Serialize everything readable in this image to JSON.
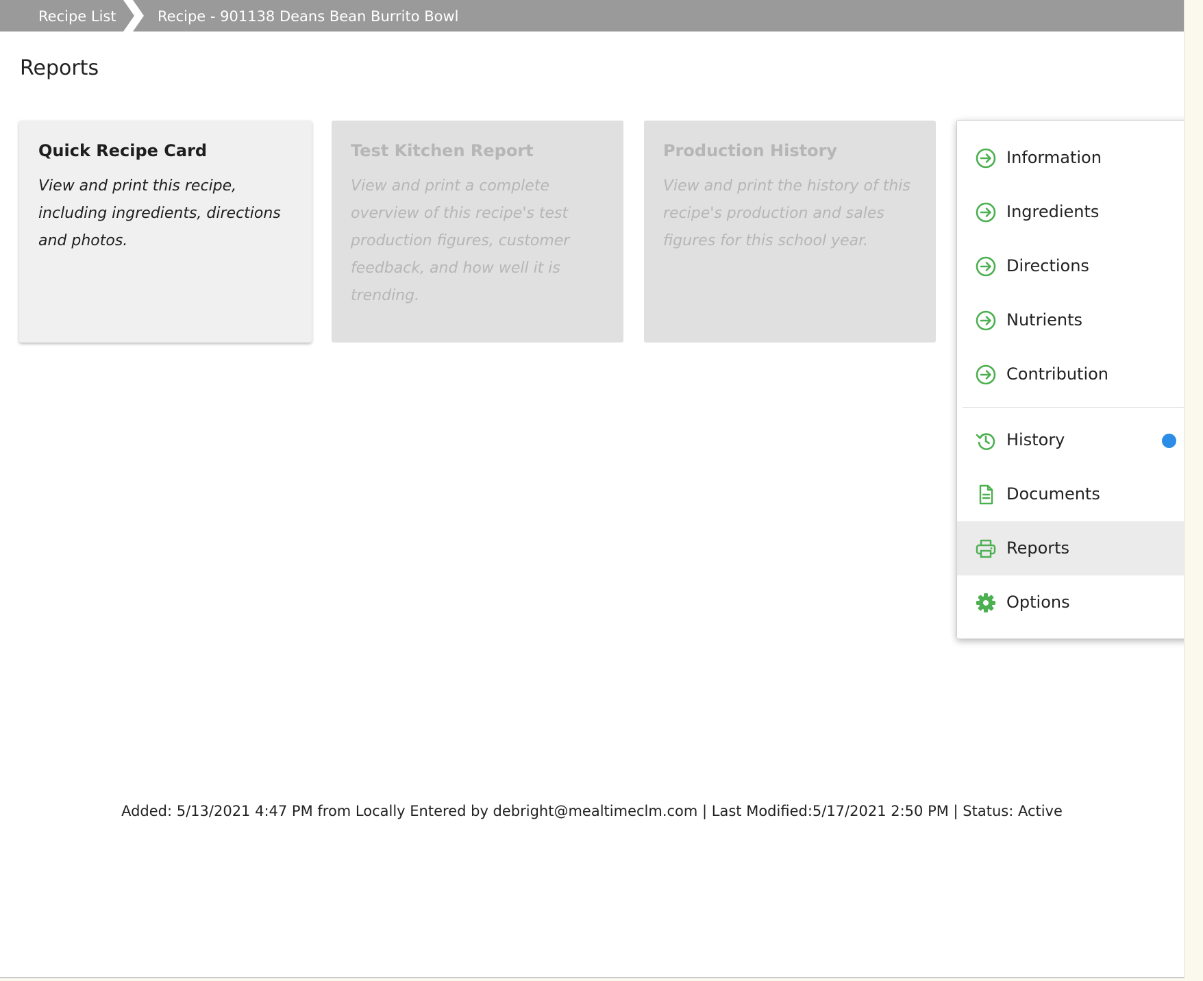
{
  "breadcrumb": {
    "items": [
      "Recipe List",
      "Recipe - 901138 Deans Bean Burrito Bowl"
    ]
  },
  "page": {
    "title": "Reports"
  },
  "cards": [
    {
      "title": "Quick Recipe Card",
      "description": "View and print this recipe, including ingredients, directions and photos.",
      "enabled": true
    },
    {
      "title": "Test Kitchen Report",
      "description": "View and print a complete overview of this recipe's test production figures, customer feedback, and how well it is trending.",
      "enabled": false
    },
    {
      "title": "Production History",
      "description": "View and print the history of this recipe's production and sales figures for this school year.",
      "enabled": false
    }
  ],
  "menu": {
    "items": [
      {
        "label": "Information",
        "icon": "arrow-circle-right-icon"
      },
      {
        "label": "Ingredients",
        "icon": "arrow-circle-right-icon"
      },
      {
        "label": "Directions",
        "icon": "arrow-circle-right-icon"
      },
      {
        "label": "Nutrients",
        "icon": "arrow-circle-right-icon"
      },
      {
        "label": "Contribution",
        "icon": "arrow-circle-right-icon"
      },
      {
        "label": "History",
        "icon": "history-icon",
        "badge": true
      },
      {
        "label": "Documents",
        "icon": "document-icon"
      },
      {
        "label": "Reports",
        "icon": "printer-icon",
        "selected": true
      },
      {
        "label": "Options",
        "icon": "gear-icon"
      }
    ]
  },
  "footer": {
    "text": "Added: 5/13/2021 4:47 PM from Locally Entered by debright@mealtimeclm.com | Last Modified:5/17/2021 2:50 PM | Status: Active"
  },
  "colors": {
    "breadcrumb_bg": "#9a9a9a",
    "icon_green": "#4caf50",
    "badge_blue": "#2b8de6",
    "selected_bg": "#ebebeb"
  }
}
